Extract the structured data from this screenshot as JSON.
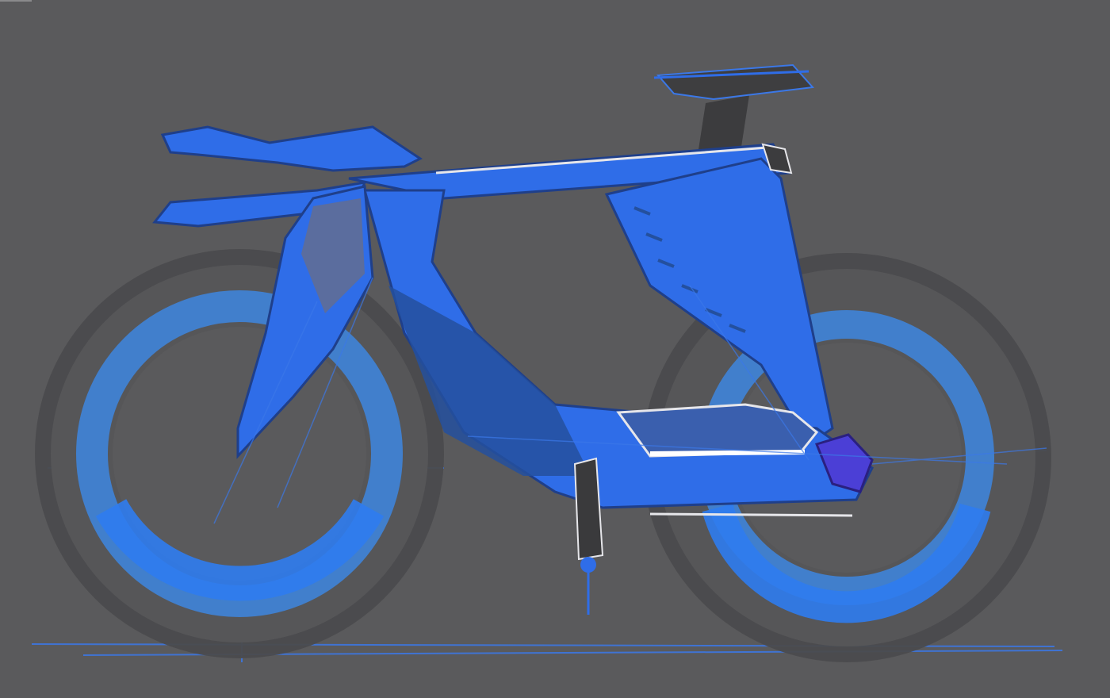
{
  "artwork": {
    "subject": "",
    "palette": {
      "background": "#5a5a5c",
      "frame_blue": "#2f6de8",
      "frame_dark": "#1f3f8a",
      "wheel_outer": "#4a4a4c",
      "wheel_ring": "#3d86e0",
      "highlight": "#e6e6ea",
      "accent_purple": "#4b3fd6",
      "construction_lines": "#3b78e8"
    }
  }
}
